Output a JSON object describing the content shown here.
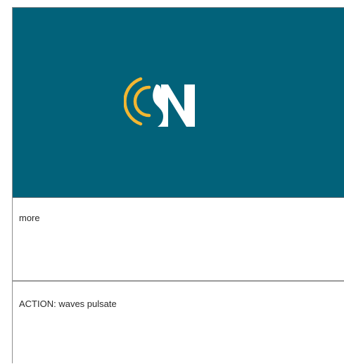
{
  "banner": {
    "background_color": "#02627a",
    "logo": {
      "icon": "wave-n-logo-icon",
      "letter": "N",
      "letter_color": "#ffffff",
      "wave_color": "#f2b632"
    }
  },
  "panels": [
    {
      "text": "more"
    },
    {
      "text": "ACTION: waves pulsate"
    }
  ]
}
